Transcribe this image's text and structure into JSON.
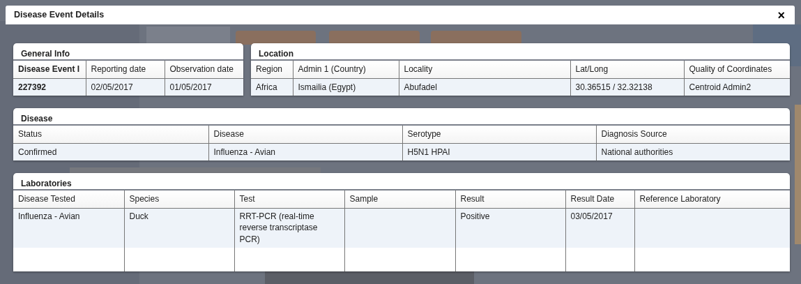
{
  "window": {
    "title": "Disease Event Details",
    "close": "×"
  },
  "general_info": {
    "title": "General Info",
    "columns": [
      "Disease Event I",
      "Reporting date",
      "Observation date"
    ],
    "rows": [
      [
        "227392",
        "02/05/2017",
        "01/05/2017"
      ]
    ]
  },
  "location": {
    "title": "Location",
    "columns": [
      "Region",
      "Admin 1 (Country)",
      "Locality",
      "Lat/Long",
      "Quality of Coordinates"
    ],
    "rows": [
      [
        "Africa",
        "Ismailia (Egypt)",
        "Abufadel",
        "30.36515 / 32.32138",
        "Centroid Admin2"
      ]
    ]
  },
  "disease": {
    "title": "Disease",
    "columns": [
      "Status",
      "Disease",
      "Serotype",
      "Diagnosis Source"
    ],
    "rows": [
      [
        "Confirmed",
        "Influenza - Avian",
        "H5N1 HPAI",
        "National authorities"
      ]
    ]
  },
  "laboratories": {
    "title": "Laboratories",
    "columns": [
      "Disease Tested",
      "Species",
      "Test",
      "Sample",
      "Result",
      "Result Date",
      "Reference Laboratory"
    ],
    "rows": [
      [
        "Influenza - Avian",
        "Duck",
        "RRT-PCR (real-time reverse transcriptase PCR)",
        "",
        "Positive",
        "03/05/2017",
        ""
      ]
    ]
  }
}
